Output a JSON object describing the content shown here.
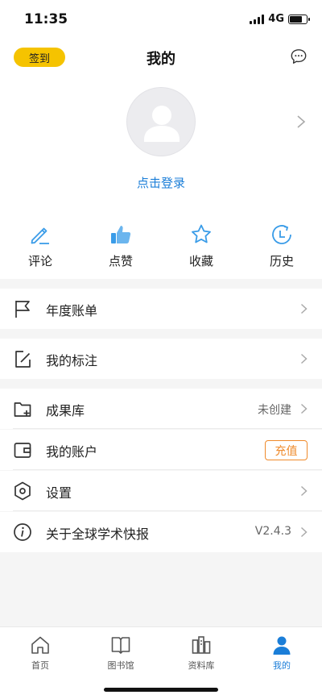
{
  "status_bar": {
    "time": "11:35",
    "network": "4G"
  },
  "header": {
    "title": "我的",
    "signin_label": "签到"
  },
  "profile": {
    "login_text": "点击登录"
  },
  "quick_actions": [
    {
      "label": "评论",
      "icon": "pencil-icon"
    },
    {
      "label": "点赞",
      "icon": "thumbs-up-icon"
    },
    {
      "label": "收藏",
      "icon": "star-icon"
    },
    {
      "label": "历史",
      "icon": "history-clock-icon"
    }
  ],
  "menu": {
    "annual_bill": {
      "label": "年度账单",
      "icon": "flag-icon"
    },
    "my_annotations": {
      "label": "我的标注",
      "icon": "edit-square-icon"
    },
    "achievements": {
      "label": "成果库",
      "value": "未创建",
      "icon": "folder-add-icon"
    },
    "my_account": {
      "label": "我的账户",
      "button": "充值",
      "icon": "wallet-icon"
    },
    "settings": {
      "label": "设置",
      "icon": "hexagon-settings-icon"
    },
    "about": {
      "label": "关于全球学术快报",
      "value": "V2.4.3",
      "icon": "info-icon"
    }
  },
  "tabbar": [
    {
      "label": "首页",
      "icon": "home-icon",
      "active": false
    },
    {
      "label": "图书馆",
      "icon": "book-icon",
      "active": false
    },
    {
      "label": "资料库",
      "icon": "library-icon",
      "active": false
    },
    {
      "label": "我的",
      "icon": "user-icon",
      "active": true
    }
  ],
  "colors": {
    "accent": "#1b7ed8",
    "signin": "#f5c300",
    "recharge": "#ef8a2b",
    "icon_blue": "#3a9ce8"
  }
}
